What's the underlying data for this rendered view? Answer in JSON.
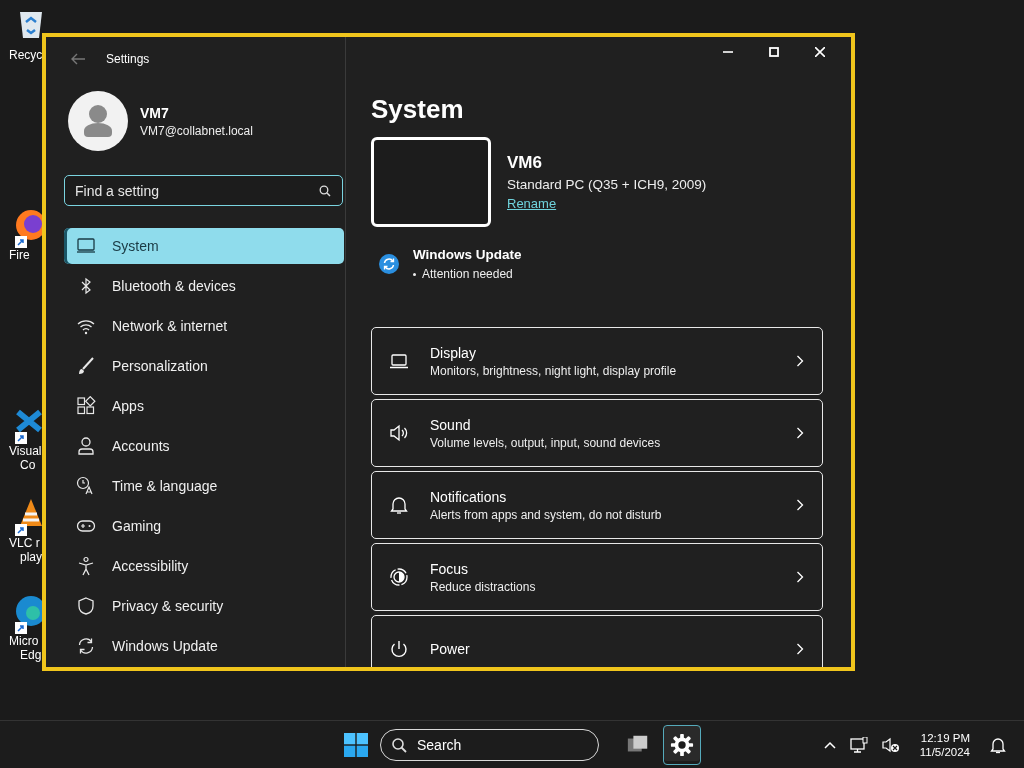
{
  "desktop_icons": [
    {
      "kind": "recycle-bin",
      "lines": [
        "Recyc"
      ]
    },
    {
      "kind": "firefox",
      "lines": [
        "Fire"
      ]
    },
    {
      "kind": "vscode",
      "lines": [
        "Visual",
        "Co"
      ]
    },
    {
      "kind": "vlc",
      "lines": [
        "VLC r",
        "play"
      ]
    },
    {
      "kind": "edge",
      "lines": [
        "Micro",
        "Edg"
      ]
    }
  ],
  "window": {
    "title": "Settings"
  },
  "user": {
    "name": "VM7",
    "email": "VM7@collabnet.local"
  },
  "search": {
    "placeholder": "Find a setting"
  },
  "sidebar": {
    "items": [
      {
        "label": "System",
        "selected": true
      },
      {
        "label": "Bluetooth & devices",
        "selected": false
      },
      {
        "label": "Network & internet",
        "selected": false
      },
      {
        "label": "Personalization",
        "selected": false
      },
      {
        "label": "Apps",
        "selected": false
      },
      {
        "label": "Accounts",
        "selected": false
      },
      {
        "label": "Time & language",
        "selected": false
      },
      {
        "label": "Gaming",
        "selected": false
      },
      {
        "label": "Accessibility",
        "selected": false
      },
      {
        "label": "Privacy & security",
        "selected": false
      },
      {
        "label": "Windows Update",
        "selected": false
      }
    ]
  },
  "page": {
    "title": "System",
    "device": {
      "name": "VM6",
      "model": "Standard PC (Q35 + ICH9, 2009)",
      "link": "Rename"
    },
    "update": {
      "title": "Windows Update",
      "status": "Attention needed"
    },
    "cards": [
      {
        "title": "Display",
        "subtitle": "Monitors, brightness, night light, display profile"
      },
      {
        "title": "Sound",
        "subtitle": "Volume levels, output, input, sound devices"
      },
      {
        "title": "Notifications",
        "subtitle": "Alerts from apps and system, do not disturb"
      },
      {
        "title": "Focus",
        "subtitle": "Reduce distractions"
      },
      {
        "title": "Power"
      }
    ]
  },
  "taskbar": {
    "search": "Search",
    "apps": [
      {
        "kind": "task-view",
        "selected": false
      },
      {
        "kind": "settings",
        "selected": true
      }
    ],
    "time": "12:19 PM",
    "date": "11/5/2024"
  }
}
